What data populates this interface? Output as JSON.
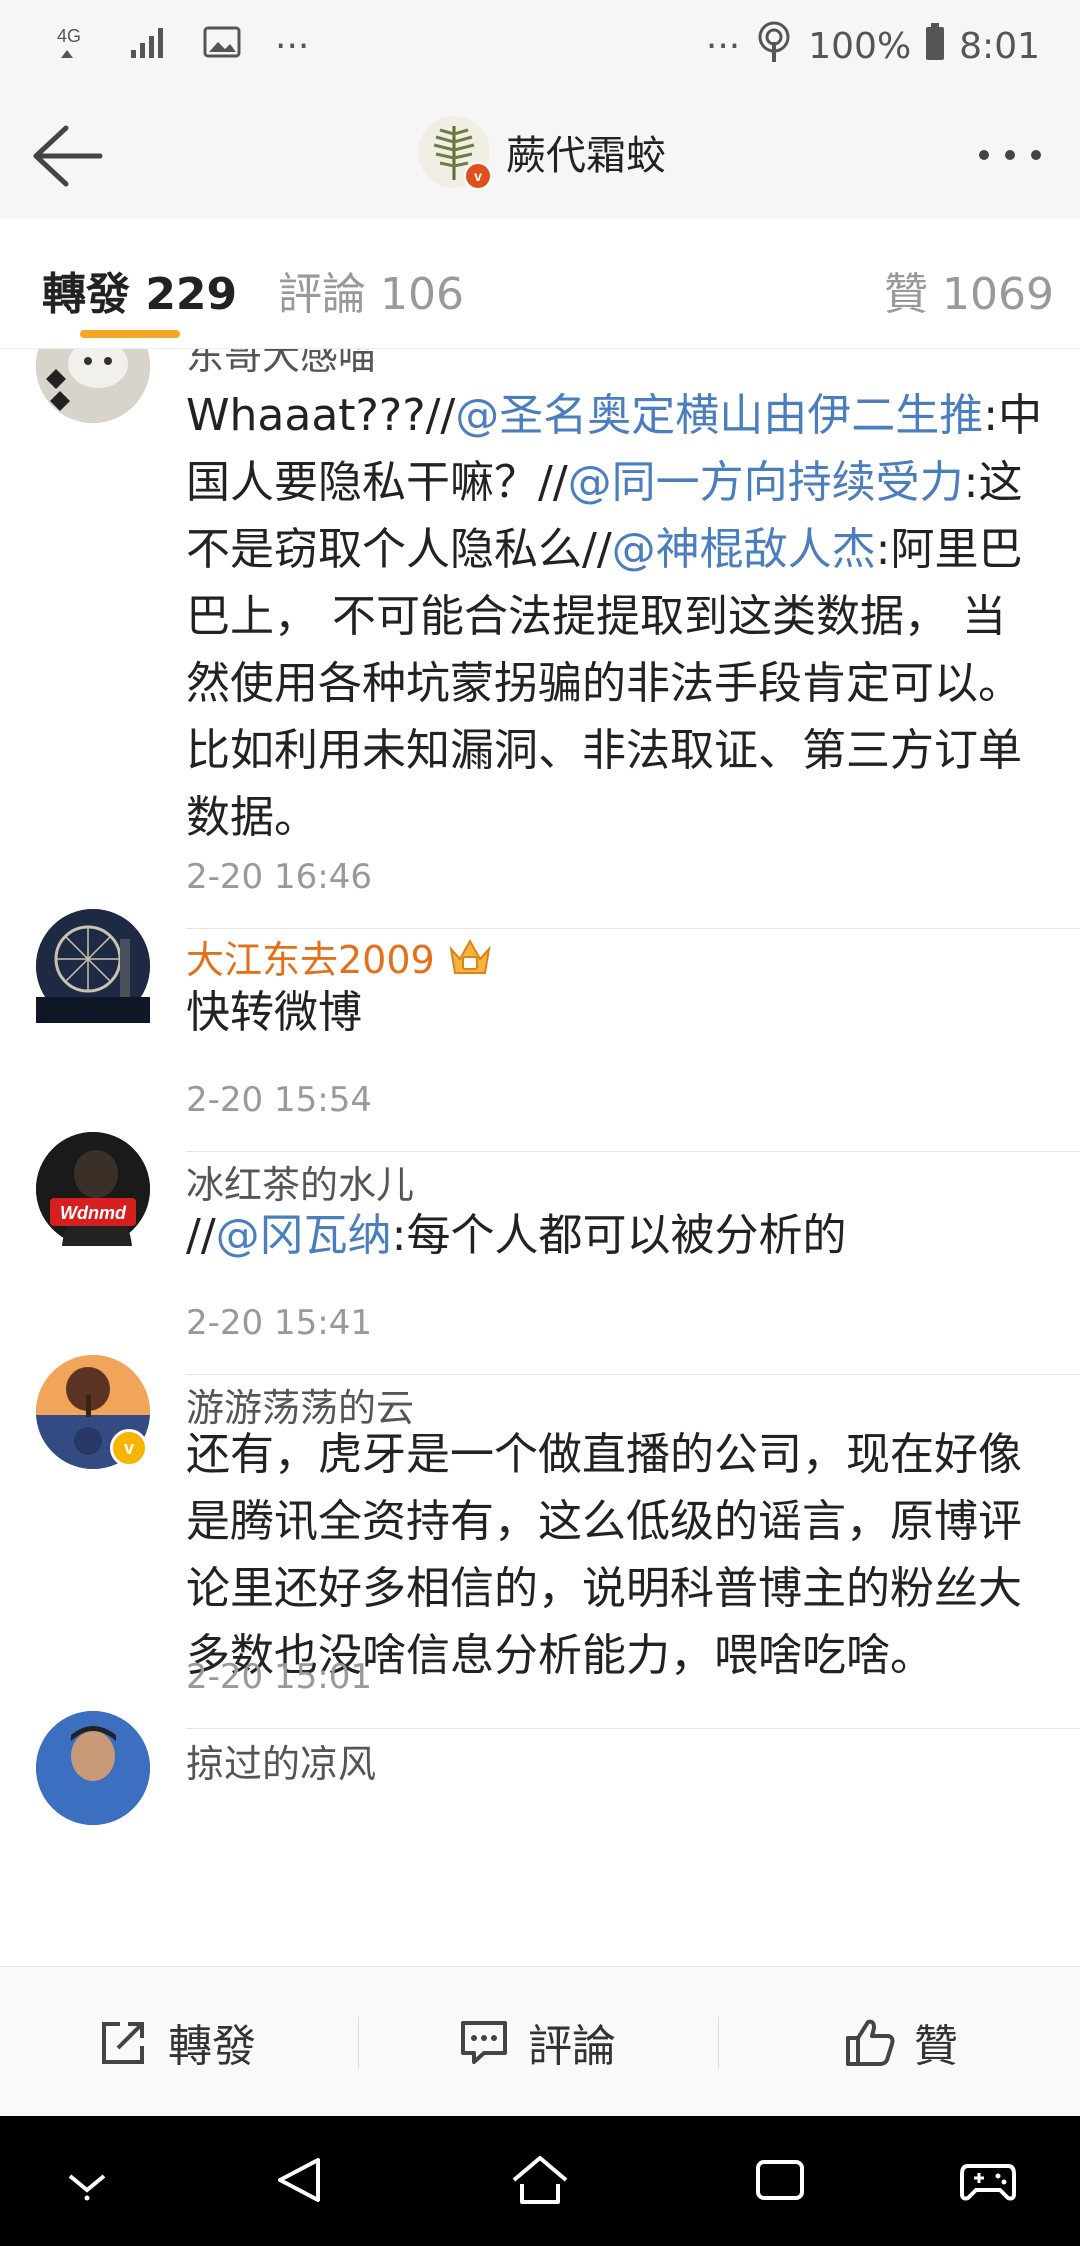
{
  "status_bar": {
    "left_icons": [
      "4g-signal-icon",
      "signal-bars-icon",
      "image-icon",
      "more-dots-icon"
    ],
    "right_icons": [
      "more-dots-icon",
      "hotspot-icon"
    ],
    "network": "4G",
    "battery": "100%",
    "time": "8:01"
  },
  "header": {
    "title": "蕨代霜蛟",
    "verified_badge": "v"
  },
  "tabs": [
    {
      "label": "轉發 229",
      "active": true
    },
    {
      "label": "評論 106",
      "active": false
    },
    {
      "label": "贊 1069",
      "active": false
    }
  ],
  "feed": {
    "items": [
      {
        "name": "东哥大感喵",
        "name_color": "gray",
        "content_parts": [
          {
            "t": "Whaaat???//"
          },
          {
            "m": "@圣名奥定横山由伊二生推"
          },
          {
            "t": ":中国人要隐私干嘛？//"
          },
          {
            "m": "@同一方向持续受力"
          },
          {
            "t": ":这不是窃取个人隐私么//"
          },
          {
            "m": "@神棍敌人杰"
          },
          {
            "t": ":阿里巴巴上， 不可能合法提提取到这类数据， 当然使用各种坑蒙拐骗的非法手段肯定可以。比如利用未知漏洞、非法取证、第三方订单数据。"
          }
        ],
        "time": "2-20 16:46"
      },
      {
        "name": "大江东去2009",
        "name_color": "orange",
        "content_parts": [
          {
            "t": "快转微博"
          }
        ],
        "time": "2-20 15:54"
      },
      {
        "name": "冰红茶的水儿",
        "name_color": "gray",
        "avatar_text": "Wdnmd",
        "content_parts": [
          {
            "t": "//"
          },
          {
            "m": "@冈瓦纳"
          },
          {
            "t": ":每个人都可以被分析的"
          }
        ],
        "time": "2-20 15:41"
      },
      {
        "name": "游游荡荡的云",
        "name_color": "gray",
        "verified_badge": "v",
        "content_parts": [
          {
            "t": "还有，虎牙是一个做直播的公司，现在好像是腾讯全资持有，这么低级的谣言，原博评论里还好多相信的，说明科普博主的粉丝大多数也没啥信息分析能力，喂啥吃啥。"
          }
        ],
        "time": "2-20 15:01"
      },
      {
        "name": "掠过的凉风",
        "name_color": "gray"
      }
    ]
  },
  "actions": {
    "repost": "轉發",
    "comment": "評論",
    "like": "贊"
  },
  "colors": {
    "accent_underline": "#f5a623",
    "mention": "#4a7ebf",
    "vip_name": "#e5701a"
  }
}
